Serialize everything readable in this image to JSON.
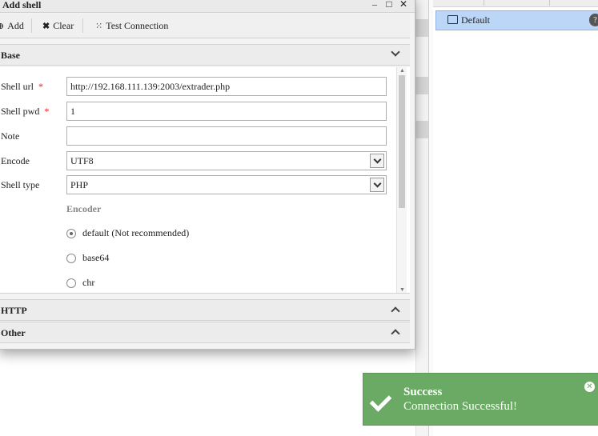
{
  "dialog": {
    "title": "Add shell",
    "controls": {
      "minimize": "–",
      "maximize": "□",
      "close": "✕"
    }
  },
  "toolbar": {
    "add_label": "Add",
    "clear_label": "Clear",
    "test_label": "Test Connection"
  },
  "sections": {
    "base": "Base",
    "http": "HTTP",
    "other": "Other"
  },
  "form": {
    "shell_url": {
      "label": "Shell url",
      "required": "*",
      "value": "http://192.168.111.139:2003/extrader.php"
    },
    "shell_pwd": {
      "label": "Shell pwd",
      "required": "*",
      "value": "1"
    },
    "note": {
      "label": "Note",
      "value": ""
    },
    "encode": {
      "label": "Encode",
      "value": "UTF8"
    },
    "shell_type": {
      "label": "Shell type",
      "value": "PHP"
    },
    "encoder": {
      "label": "Encoder",
      "options": [
        "default (Not recommended)",
        "base64",
        "chr"
      ],
      "selected": "default (Not recommended)"
    }
  },
  "right_panel": {
    "category": "Default",
    "help": "?"
  },
  "toast": {
    "title": "Success",
    "message": "Connection Successful!",
    "color": "#6aaa64"
  }
}
